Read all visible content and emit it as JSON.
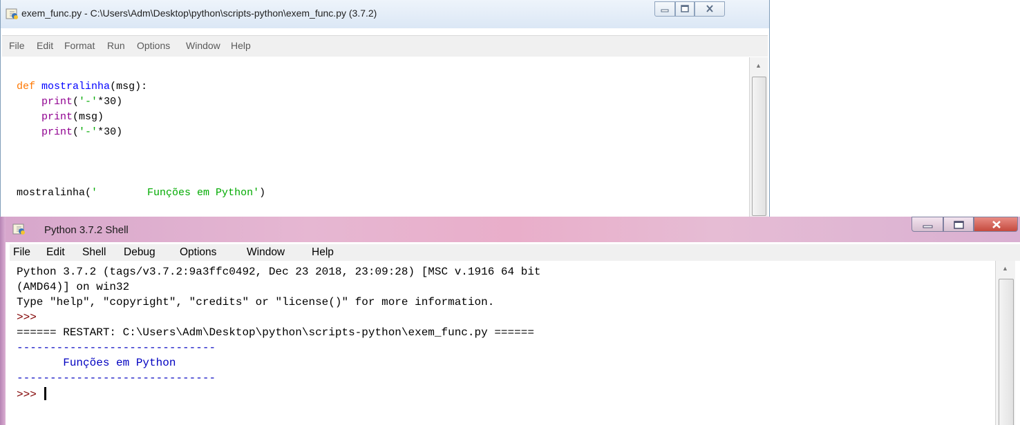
{
  "editor": {
    "title": "exem_func.py - C:\\Users\\Adm\\Desktop\\python\\scripts-python\\exem_func.py (3.7.2)",
    "menu": [
      "File",
      "Edit",
      "Format",
      "Run",
      "Options",
      "Window",
      "Help"
    ],
    "code": {
      "l1_kw": "def",
      "l1_fn": "mostralinha",
      "l1_rest": "(msg):",
      "l2_bi": "print",
      "l2_open": "(",
      "l2_str": "'-'",
      "l2_rest": "*30)",
      "l3_bi": "print",
      "l3_rest": "(msg)",
      "l4_bi": "print",
      "l4_open": "(",
      "l4_str": "'-'",
      "l4_rest": "*30)",
      "l5_call": "mostralinha(",
      "l5_str": "'        Funções em Python'",
      "l5_close": ")"
    }
  },
  "shell": {
    "title": "Python 3.7.2 Shell",
    "menu": [
      "File",
      "Edit",
      "Shell",
      "Debug",
      "Options",
      "Window",
      "Help"
    ],
    "banner_line1": "Python 3.7.2 (tags/v3.7.2:9a3ffc0492, Dec 23 2018, 23:09:28) [MSC v.1916 64 bit",
    "banner_line2": "(AMD64)] on win32",
    "banner_line3": "Type \"help\", \"copyright\", \"credits\" or \"license()\" for more information.",
    "prompt": ">>>",
    "restart_line": "====== RESTART: C:\\Users\\Adm\\Desktop\\python\\scripts-python\\exem_func.py ======",
    "output_rule": "------------------------------",
    "output_msg": "       Funções em Python",
    "prompt2": ">>>"
  },
  "colors": {
    "keyword": "#ff7700",
    "definition": "#0000ff",
    "builtin": "#900090",
    "string": "#00aa00",
    "prompt": "#800000",
    "stdout": "#0000c0"
  }
}
